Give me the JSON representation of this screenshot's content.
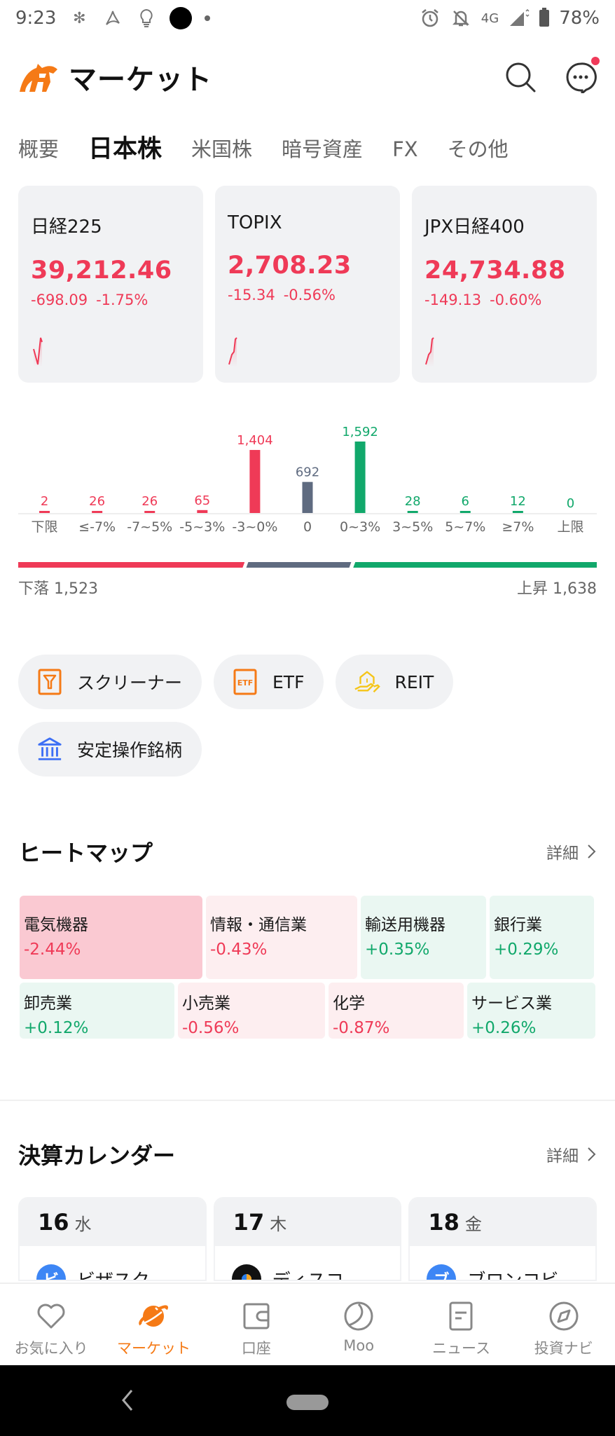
{
  "status_bar": {
    "time": "9:23",
    "network": "4G",
    "battery": "78%"
  },
  "header": {
    "title": "マーケット"
  },
  "tabs": [
    {
      "label": "概要",
      "active": false
    },
    {
      "label": "日本株",
      "active": true
    },
    {
      "label": "米国株",
      "active": false
    },
    {
      "label": "暗号資産",
      "active": false
    },
    {
      "label": "FX",
      "active": false
    },
    {
      "label": "その他",
      "active": false
    }
  ],
  "indices": [
    {
      "name": "日経225",
      "price": "39,212.46",
      "change": "-698.09",
      "change_pct": "-1.75%"
    },
    {
      "name": "TOPIX",
      "price": "2,708.23",
      "change": "-15.34",
      "change_pct": "-0.56%"
    },
    {
      "name": "JPX日経400",
      "price": "24,734.88",
      "change": "-149.13",
      "change_pct": "-0.60%"
    }
  ],
  "colors": {
    "down": "#ef3a57",
    "up": "#11a86b",
    "flat": "#5f6b80",
    "accent": "#f57a16"
  },
  "chart_data": {
    "type": "bar",
    "title": "",
    "xlabel": "",
    "ylabel": "",
    "categories": [
      "下限",
      "≤-7%",
      "-7~5%",
      "-5~3%",
      "-3~0%",
      "0",
      "0~3%",
      "3~5%",
      "5~7%",
      "≥7%",
      "上限"
    ],
    "values": [
      2,
      26,
      26,
      65,
      1404,
      692,
      1592,
      28,
      6,
      12,
      0
    ],
    "value_labels": [
      "2",
      "26",
      "26",
      "65",
      "1,404",
      "692",
      "1,592",
      "28",
      "6",
      "12",
      "0"
    ],
    "series_color_class": [
      "down",
      "down",
      "down",
      "down",
      "down",
      "flat",
      "up",
      "up",
      "up",
      "up",
      "up"
    ],
    "ylim": [
      0,
      1592
    ],
    "grid": false
  },
  "breadth": {
    "declining_label": "下落",
    "declining": 1523,
    "declining_text": "1,523",
    "unchanged": 692,
    "advancing_label": "上昇",
    "advancing": 1638,
    "advancing_text": "1,638"
  },
  "shortcuts": [
    {
      "label": "スクリーナー",
      "icon": "screener-filter-icon"
    },
    {
      "label": "ETF",
      "icon": "etf-icon"
    },
    {
      "label": "REIT",
      "icon": "reit-house-hand-icon"
    },
    {
      "label": "安定操作銘柄",
      "icon": "bank-building-icon"
    }
  ],
  "heatmap": {
    "title": "ヒートマップ",
    "more_label": "詳細",
    "rows": [
      [
        {
          "name": "電気機器",
          "value": "-2.44%"
        },
        {
          "name": "情報・通信業",
          "value": "-0.43%"
        },
        {
          "name": "輸送用機器",
          "value": "+0.35%"
        },
        {
          "name": "銀行業",
          "value": "+0.29%"
        }
      ],
      [
        {
          "name": "卸売業",
          "value": "+0.12%"
        },
        {
          "name": "小売業",
          "value": "-0.56%"
        },
        {
          "name": "化学",
          "value": "-0.87%"
        },
        {
          "name": "サービス業",
          "value": "+0.26%"
        }
      ]
    ]
  },
  "earnings_calendar": {
    "title": "決算カレンダー",
    "more_label": "詳細",
    "days": [
      {
        "day": "16",
        "weekday": "水",
        "company": "ビザスク",
        "logo_char": "ビ"
      },
      {
        "day": "17",
        "weekday": "木",
        "company": "ディスコ",
        "logo_char": ""
      },
      {
        "day": "18",
        "weekday": "金",
        "company": "ブロンコビ…",
        "logo_char": "ブ"
      }
    ]
  },
  "bottom_nav": [
    {
      "label": "お気に入り",
      "icon": "heart-icon",
      "active": false
    },
    {
      "label": "マーケット",
      "icon": "planet-icon",
      "active": true
    },
    {
      "label": "口座",
      "icon": "wallet-icon",
      "active": false
    },
    {
      "label": "Moo",
      "icon": "moo-icon",
      "active": false
    },
    {
      "label": "ニュース",
      "icon": "news-icon",
      "active": false
    },
    {
      "label": "投資ナビ",
      "icon": "compass-icon",
      "active": false
    }
  ]
}
